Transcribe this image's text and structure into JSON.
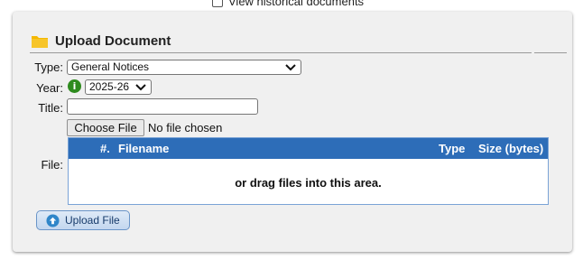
{
  "top": {
    "historical_label": "View historical documents"
  },
  "panel": {
    "title": "Upload Document",
    "type_label": "Type:",
    "type_value": "General Notices",
    "year_label": "Year:",
    "year_info": "i",
    "year_value": "2025-26",
    "title_label": "Title:",
    "title_value": "",
    "choose_file_label": "Choose File",
    "no_file_text": "No file chosen",
    "file_label": "File:",
    "table": {
      "col_num": "#.",
      "col_filename": "Filename",
      "col_type": "Type",
      "col_size": "Size (bytes)",
      "drop_text": "or drag files into this area."
    },
    "upload_button": "Upload File"
  },
  "colors": {
    "accent": "#2d6db8",
    "folder": "#f5b800",
    "info": "#2e8b1e"
  },
  "icons": {
    "folder": "folder-icon",
    "info": "info-icon",
    "upload": "upload-arrow-icon",
    "chevron": "chevron-down-icon"
  }
}
